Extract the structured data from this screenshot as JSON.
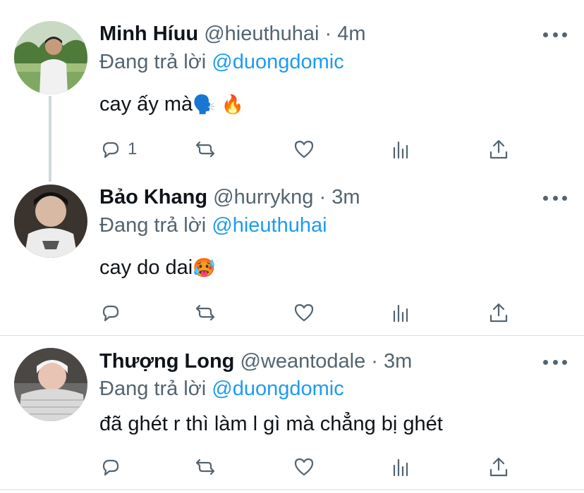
{
  "tweets": [
    {
      "name": "Minh Híuu",
      "handle": "@hieuthuhai",
      "time": "4m",
      "reply_prefix": "Đang trả lời",
      "reply_to": "@duongdomic",
      "text": "cay ấy mà",
      "emoji": "🗣️ 🔥",
      "reply_count": "1"
    },
    {
      "name": "Bảo Khang",
      "handle": "@hurrykng",
      "time": "3m",
      "reply_prefix": "Đang trả lời",
      "reply_to": "@hieuthuhai",
      "text": "cay do dai",
      "emoji": "🥵",
      "reply_count": ""
    },
    {
      "name": "Thượng Long",
      "handle": "@weantodale",
      "time": "3m",
      "reply_prefix": "Đang trả lời",
      "reply_to": "@duongdomic",
      "text": "đã ghét r thì làm l gì mà chẳng bị ghét",
      "emoji": "",
      "reply_count": ""
    }
  ],
  "separator": "·",
  "icons": [
    "reply-icon",
    "retweet-icon",
    "like-icon",
    "analytics-icon",
    "share-icon",
    "more-icon"
  ],
  "colors": {
    "mention": "#1d9bf0",
    "secondary": "#536471",
    "thread_line": "#cfd9de"
  }
}
